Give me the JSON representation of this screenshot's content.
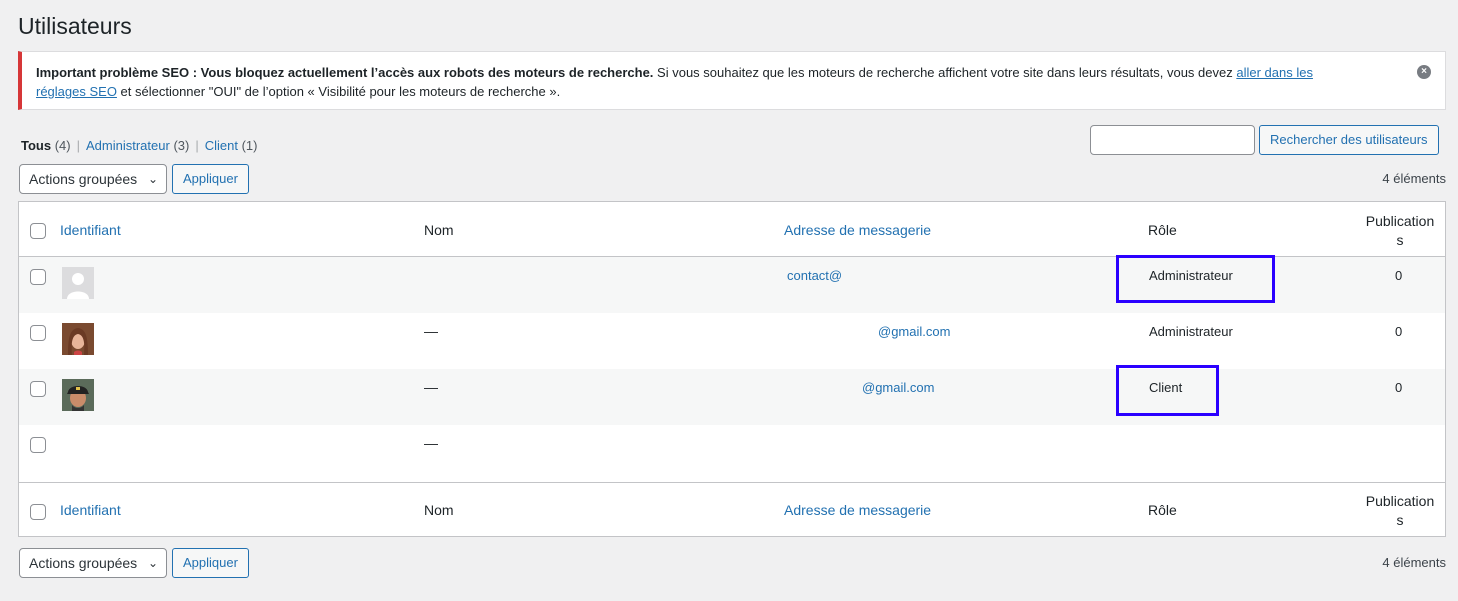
{
  "page_title": "Utilisateurs",
  "notice": {
    "strong": "Important problème SEO : Vous bloquez actuellement l’accès aux robots des moteurs de recherche.",
    "text1": " Si vous souhaitez que les moteurs de recherche affichent votre site dans leurs résultats, vous devez ",
    "link1": "aller dans les",
    "link2": "réglages SEO",
    "text2": " et sélectionner \"OUI\" de l’option « Visibilité pour les moteurs de recherche ».",
    "close": "×"
  },
  "filters": {
    "all": "Tous",
    "all_count": "(4)",
    "admin": "Administrateur",
    "admin_count": "(3)",
    "client": "Client",
    "client_count": "(1)",
    "sep": "|"
  },
  "search": {
    "button": "Rechercher des utilisateurs",
    "value": ""
  },
  "bulk": {
    "label": "Actions groupées",
    "apply": "Appliquer",
    "chev": "⌄"
  },
  "count": "4 éléments",
  "columns": {
    "username": "Identifiant",
    "name": "Nom",
    "email": "Adresse de messagerie",
    "role": "Rôle",
    "posts1": "Publication",
    "posts2": "s"
  },
  "rows": [
    {
      "name": "",
      "email": "contact@",
      "role": "Administrateur",
      "posts": "0"
    },
    {
      "name": "—",
      "email": "@gmail.com",
      "role": "Administrateur",
      "posts": "0"
    },
    {
      "name": "—",
      "email": "@gmail.com",
      "role": "Client",
      "posts": "0"
    },
    {
      "name": "—",
      "email": "",
      "role": "",
      "posts": ""
    }
  ],
  "colors": {
    "accent": "#2271b1",
    "notice_border": "#d63638",
    "highlight": "#2b00ff"
  }
}
